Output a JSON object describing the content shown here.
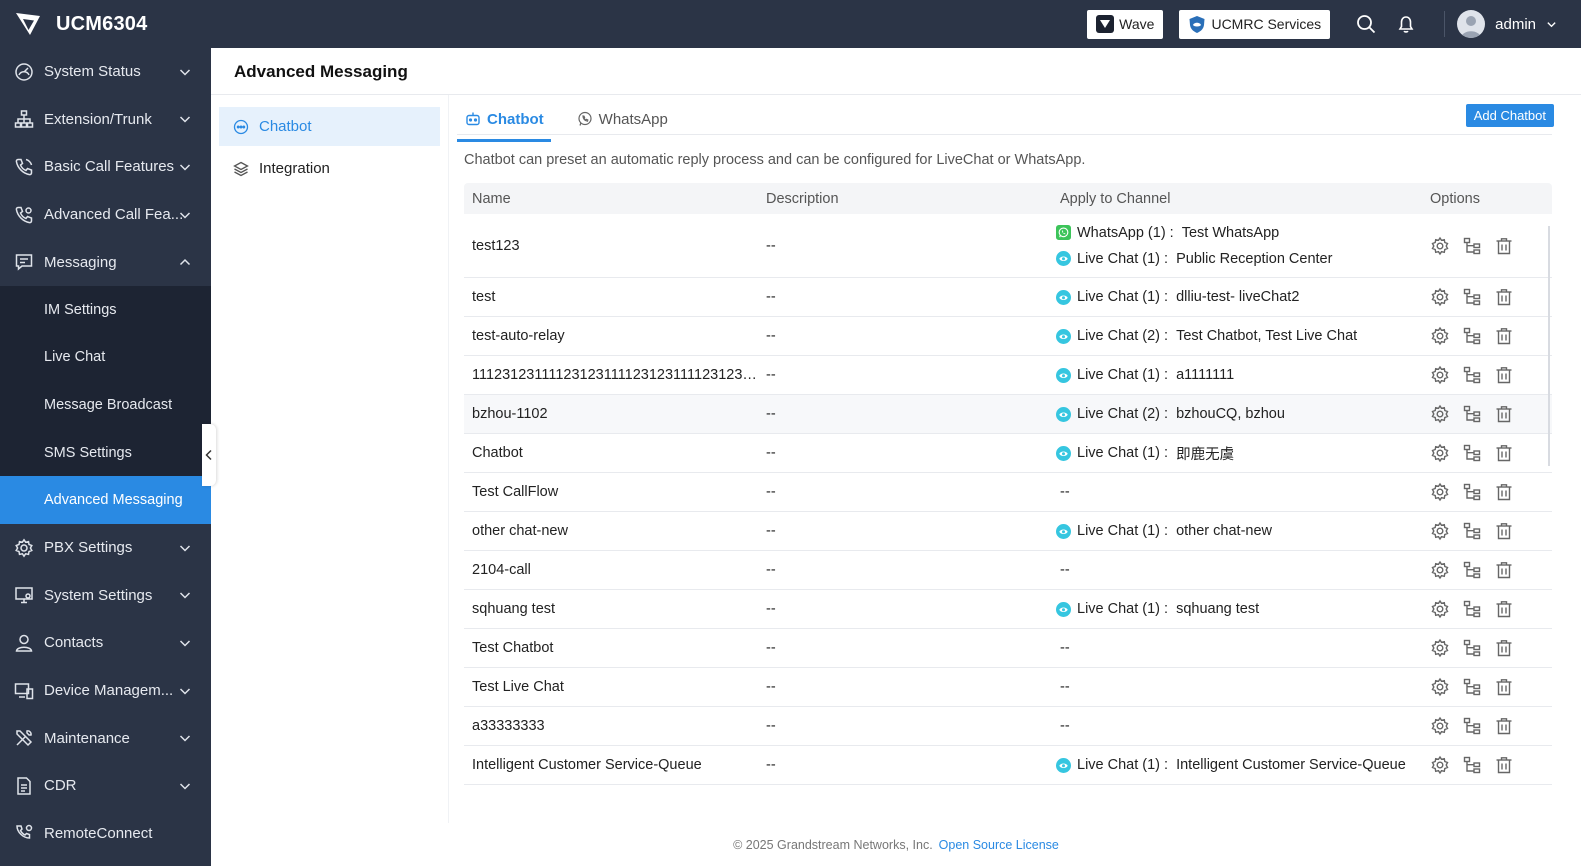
{
  "app": {
    "brand": "UCM6304"
  },
  "topbar": {
    "wave_label": "Wave",
    "ucmrc_label": "UCMRC Services",
    "user_name": "admin"
  },
  "sidebar": {
    "items": [
      {
        "label": "System Status",
        "icon": "gauge-icon"
      },
      {
        "label": "Extension/Trunk",
        "icon": "sitemap-icon"
      },
      {
        "label": "Basic Call Features",
        "icon": "phone-icon"
      },
      {
        "label": "Advanced Call Fea...",
        "icon": "phone-settings-icon"
      },
      {
        "label": "Messaging",
        "icon": "message-icon"
      },
      {
        "label": "PBX Settings",
        "icon": "gear-icon"
      },
      {
        "label": "System Settings",
        "icon": "monitor-settings-icon"
      },
      {
        "label": "Contacts",
        "icon": "person-icon"
      },
      {
        "label": "Device Managem...",
        "icon": "devices-icon"
      },
      {
        "label": "Maintenance",
        "icon": "tools-icon"
      },
      {
        "label": "CDR",
        "icon": "document-icon"
      },
      {
        "label": "RemoteConnect",
        "icon": "remote-icon"
      }
    ],
    "messaging_sub": [
      "IM Settings",
      "Live Chat",
      "Message Broadcast",
      "SMS Settings",
      "Advanced Messaging"
    ]
  },
  "page": {
    "title": "Advanced Messaging"
  },
  "leftpanel": {
    "items": [
      "Chatbot",
      "Integration"
    ]
  },
  "tabs": [
    "Chatbot",
    "WhatsApp"
  ],
  "toolbar": {
    "add_label": "Add Chatbot"
  },
  "description": "Chatbot can preset an automatic reply process and can be configured for LiveChat or WhatsApp.",
  "table": {
    "headers": [
      "Name",
      "Description",
      "Apply to Channel",
      "Options"
    ],
    "rows": [
      {
        "name": "test123",
        "desc": "--",
        "channels": [
          {
            "type": "whatsapp",
            "label": "WhatsApp (1) :",
            "value": "Test WhatsApp"
          },
          {
            "type": "livechat",
            "label": "Live Chat (1) :",
            "value": "Public Reception Center"
          }
        ]
      },
      {
        "name": "test",
        "desc": "--",
        "channels": [
          {
            "type": "livechat",
            "label": "Live Chat (1) :",
            "value": "dlliu-test- liveChat2"
          }
        ]
      },
      {
        "name": "test-auto-relay",
        "desc": "--",
        "channels": [
          {
            "type": "livechat",
            "label": "Live Chat (2) :",
            "value": "Test Chatbot, Test Live Chat"
          }
        ]
      },
      {
        "name": "11123123111123123111123123111123123111231...",
        "desc": "--",
        "channels": [
          {
            "type": "livechat",
            "label": "Live Chat (1) :",
            "value": "a1111111"
          }
        ]
      },
      {
        "name": "bzhou-1102",
        "desc": "--",
        "hover": true,
        "channels": [
          {
            "type": "livechat",
            "label": "Live Chat (2) :",
            "value": "bzhouCQ, bzhou"
          }
        ]
      },
      {
        "name": "Chatbot",
        "desc": "--",
        "channels": [
          {
            "type": "livechat",
            "label": "Live Chat (1) :",
            "value": "即鹿无虞"
          }
        ]
      },
      {
        "name": "Test CallFlow",
        "desc": "--",
        "channels": [],
        "empty": "--"
      },
      {
        "name": "other chat-new",
        "desc": "--",
        "channels": [
          {
            "type": "livechat",
            "label": "Live Chat (1) :",
            "value": "other chat-new"
          }
        ]
      },
      {
        "name": "2104-call",
        "desc": "--",
        "channels": [],
        "empty": "--"
      },
      {
        "name": "sqhuang test",
        "desc": "--",
        "channels": [
          {
            "type": "livechat",
            "label": "Live Chat (1) :",
            "value": "sqhuang test"
          }
        ]
      },
      {
        "name": "Test Chatbot",
        "desc": "--",
        "channels": [],
        "empty": "--"
      },
      {
        "name": "Test Live Chat",
        "desc": "--",
        "channels": [],
        "empty": "--"
      },
      {
        "name": "a33333333",
        "desc": "--",
        "channels": [],
        "empty": "--"
      },
      {
        "name": "Intelligent Customer Service-Queue",
        "desc": "--",
        "channels": [
          {
            "type": "livechat",
            "label": "Live Chat (1) :",
            "value": "Intelligent Customer Service-Queue"
          }
        ]
      }
    ]
  },
  "footer": {
    "copyright": "© 2025 Grandstream Networks, Inc.",
    "link": "Open Source License"
  },
  "colors": {
    "accent": "#2a8ae3",
    "sidebar": "#2b3446",
    "whatsapp": "#3cc45a",
    "livechat": "#36c6e0"
  }
}
